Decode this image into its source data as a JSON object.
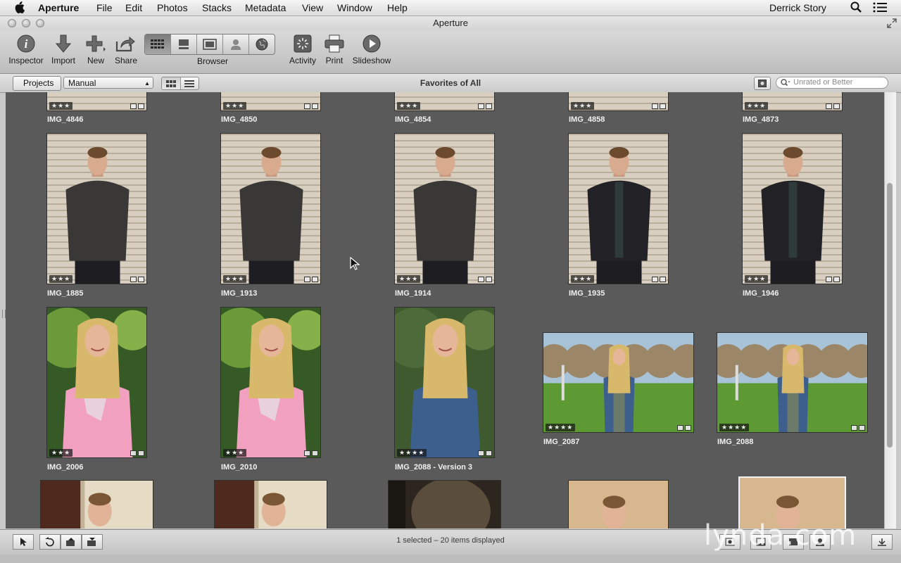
{
  "menubar": {
    "app": "Aperture",
    "items": [
      "File",
      "Edit",
      "Photos",
      "Stacks",
      "Metadata",
      "View",
      "Window",
      "Help"
    ],
    "user": "Derrick Story"
  },
  "window": {
    "title": "Aperture"
  },
  "toolbar": {
    "inspector": "Inspector",
    "import": "Import",
    "new": "New",
    "share": "Share",
    "browser": "Browser",
    "activity": "Activity",
    "print": "Print",
    "slideshow": "Slideshow"
  },
  "navbar": {
    "projects": "Projects",
    "sort": "Manual",
    "album_title": "Favorites of All",
    "search_placeholder": "Unrated or Better"
  },
  "photos": [
    {
      "name": "IMG_4846",
      "rating": "★★★",
      "rating_value": 3
    },
    {
      "name": "IMG_4850",
      "rating": "★★★",
      "rating_value": 3
    },
    {
      "name": "IMG_4854",
      "rating": "★★★",
      "rating_value": 3
    },
    {
      "name": "IMG_4858",
      "rating": "★★★",
      "rating_value": 3
    },
    {
      "name": "IMG_4873",
      "rating": "★★★",
      "rating_value": 3
    },
    {
      "name": "IMG_1885",
      "rating": "★★★",
      "rating_value": 3
    },
    {
      "name": "IMG_1913",
      "rating": "★★★",
      "rating_value": 3
    },
    {
      "name": "IMG_1914",
      "rating": "★★★",
      "rating_value": 3
    },
    {
      "name": "IMG_1935",
      "rating": "★★★",
      "rating_value": 3
    },
    {
      "name": "IMG_1946",
      "rating": "★★★",
      "rating_value": 3
    },
    {
      "name": "IMG_2006",
      "rating": "★★★",
      "rating_value": 3
    },
    {
      "name": "IMG_2010",
      "rating": "★★★",
      "rating_value": 3
    },
    {
      "name": "IMG_2088 - Version 3",
      "rating": "★★★★",
      "rating_value": 4
    },
    {
      "name": "IMG_2087",
      "rating": "★★★★",
      "rating_value": 4
    },
    {
      "name": "IMG_2088",
      "rating": "★★★★",
      "rating_value": 4
    }
  ],
  "status": {
    "text": "1 selected – 20 items displayed"
  },
  "watermark": "lynda.com",
  "colors": {
    "grid_bg": "#5a5a5a",
    "selection": "#f2f2f2"
  }
}
